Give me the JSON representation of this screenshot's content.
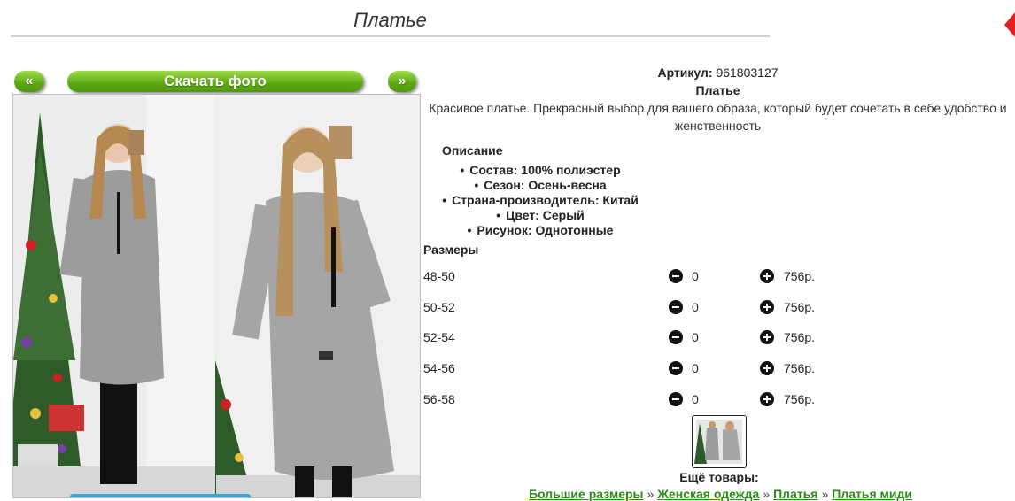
{
  "page": {
    "title": "Платье"
  },
  "gallery": {
    "prev_label": "«",
    "next_label": "»",
    "download_label": "Скачать фото"
  },
  "product": {
    "article_label": "Артикул:",
    "article_value": "961803127",
    "name": "Платье",
    "description": "Красивое платье. Прекрасный выбор для вашего образа, который будет сочетать в себе удобство и женственность",
    "description_heading": "Описание",
    "attributes": [
      "Состав: 100% полиэстер",
      "Сезон: Осень-весна",
      "Страна-производитель: Китай",
      "Цвет: Серый",
      "Рисунок: Однотонные"
    ]
  },
  "sizes": {
    "heading": "Размеры",
    "rows": [
      {
        "size": "48-50",
        "qty": "0",
        "price": "756р."
      },
      {
        "size": "50-52",
        "qty": "0",
        "price": "756р."
      },
      {
        "size": "52-54",
        "qty": "0",
        "price": "756р."
      },
      {
        "size": "54-56",
        "qty": "0",
        "price": "756р."
      },
      {
        "size": "56-58",
        "qty": "0",
        "price": "756р."
      }
    ]
  },
  "more": {
    "heading": "Ещё товары:",
    "breadcrumbs": [
      "Большие размеры",
      "Женская одежда",
      "Платья",
      "Платья миди"
    ],
    "separator": "»"
  },
  "icons": {
    "prev": "chevron-double-left-icon",
    "next": "chevron-double-right-icon",
    "minus": "minus-circle-icon",
    "plus": "plus-circle-icon"
  },
  "colors": {
    "accent_green": "#5da713",
    "link_green": "#2a8a16",
    "corner_red": "#e02020"
  }
}
